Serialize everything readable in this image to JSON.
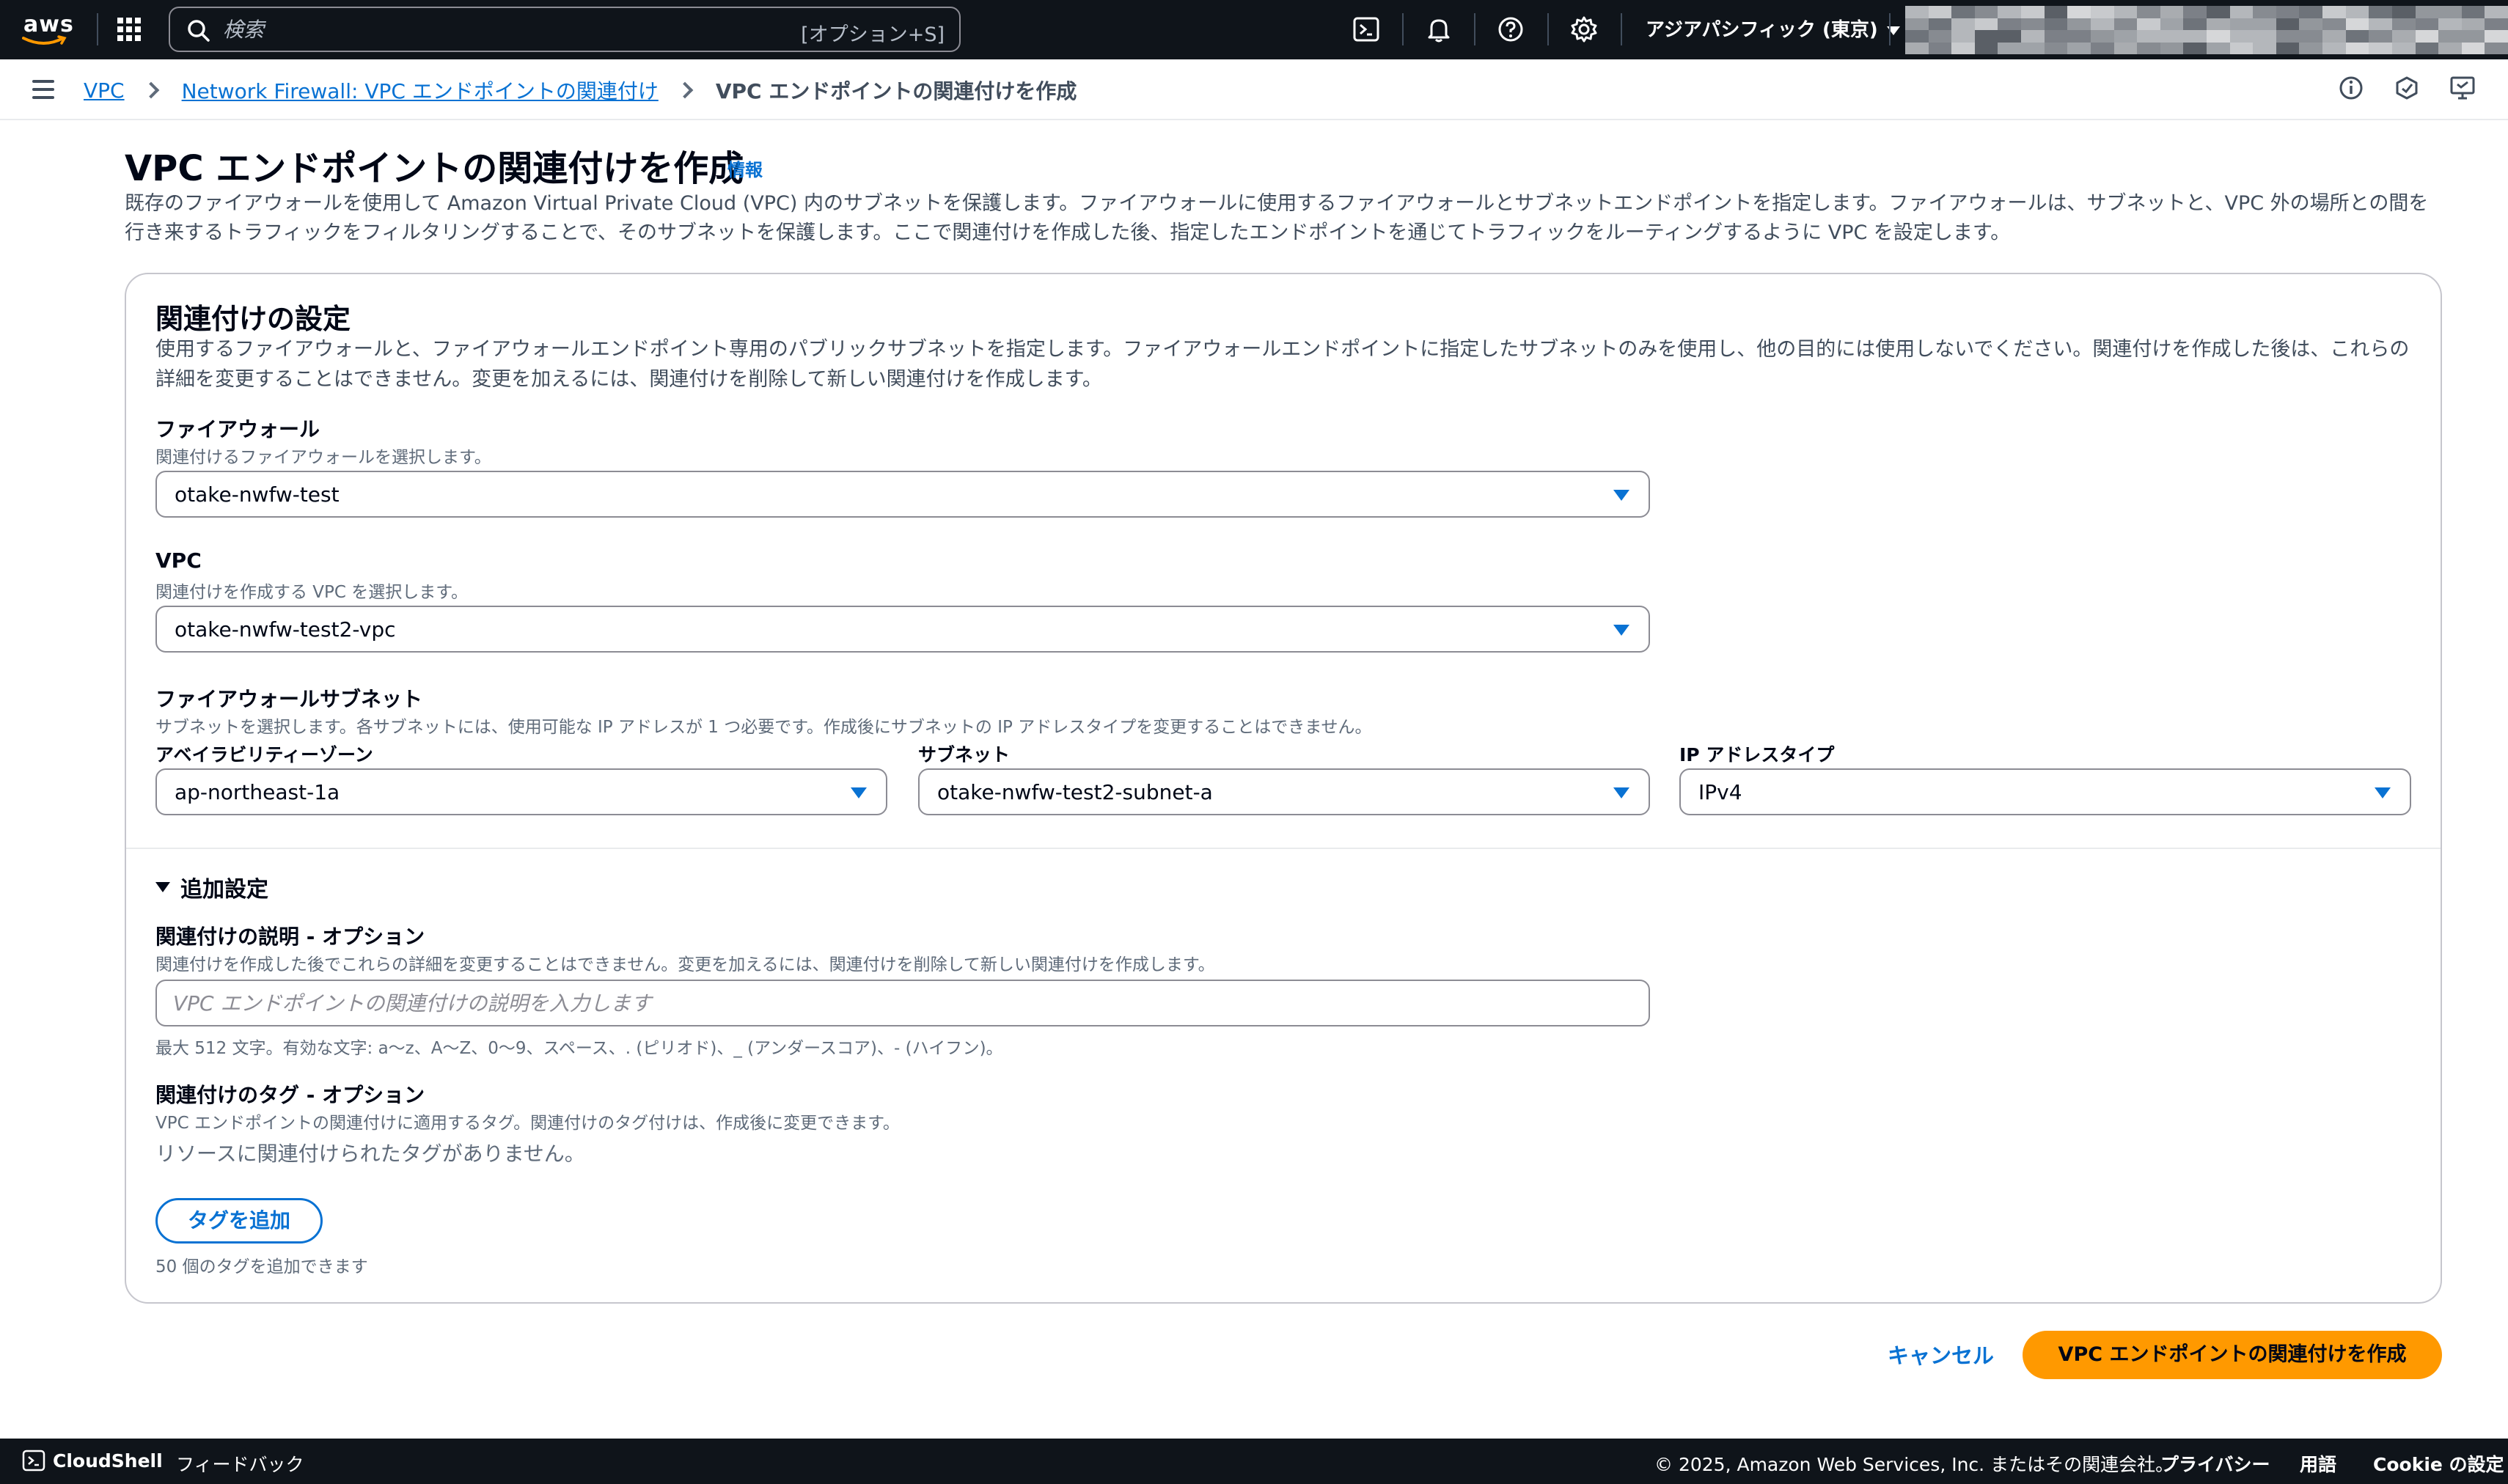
{
  "header": {
    "logo_text": "aws",
    "search": {
      "placeholder": "検索",
      "shortcut": "[オプション+S]"
    },
    "region": "アジアパシフィック (東京)"
  },
  "breadcrumb": {
    "items": [
      "VPC",
      "Network Firewall: VPC エンドポイントの関連付け"
    ],
    "current": "VPC エンドポイントの関連付けを作成"
  },
  "page": {
    "title": "VPC エンドポイントの関連付けを作成",
    "info_label": "情報",
    "description": "既存のファイアウォールを使用して Amazon Virtual Private Cloud (VPC) 内のサブネットを保護します。ファイアウォールに使用するファイアウォールとサブネットエンドポイントを指定します。ファイアウォールは、サブネットと、VPC 外の場所との間を行き来するトラフィックをフィルタリングすることで、そのサブネットを保護します。ここで関連付けを作成した後、指定したエンドポイントを通じてトラフィックをルーティングするように VPC を設定します。"
  },
  "panel": {
    "title": "関連付けの設定",
    "description": "使用するファイアウォールと、ファイアウォールエンドポイント専用のパブリックサブネットを指定します。ファイアウォールエンドポイントに指定したサブネットのみを使用し、他の目的には使用しないでください。関連付けを作成した後は、これらの詳細を変更することはできません。変更を加えるには、関連付けを削除して新しい関連付けを作成します。",
    "firewall": {
      "label": "ファイアウォール",
      "description": "関連付けるファイアウォールを選択します。",
      "value": "otake-nwfw-test"
    },
    "vpc": {
      "label": "VPC",
      "description": "関連付けを作成する VPC を選択します。",
      "value": "otake-nwfw-test2-vpc"
    },
    "subnets": {
      "label": "ファイアウォールサブネット",
      "description": "サブネットを選択します。各サブネットには、使用可能な IP アドレスが 1 つ必要です。作成後にサブネットの IP アドレスタイプを変更することはできません。",
      "az_label": "アベイラビリティーゾーン",
      "az_value": "ap-northeast-1a",
      "subnet_label": "サブネット",
      "subnet_value": "otake-nwfw-test2-subnet-a",
      "ip_label": "IP アドレスタイプ",
      "ip_value": "IPv4"
    },
    "additional": {
      "label": "追加設定",
      "description_field": {
        "label": "関連付けの説明 - オプション",
        "description": "関連付けを作成した後でこれらの詳細を変更することはできません。変更を加えるには、関連付けを削除して新しい関連付けを作成します。",
        "placeholder": "VPC エンドポイントの関連付けの説明を入力します",
        "value": "",
        "hint": "最大 512 文字。有効な文字: a〜z、A〜Z、0〜9、スペース、. (ピリオド)、_ (アンダースコア)、- (ハイフン)。"
      },
      "tags": {
        "label": "関連付けのタグ - オプション",
        "description": "VPC エンドポイントの関連付けに適用するタグ。関連付けのタグ付けは、作成後に変更できます。",
        "empty": "リソースに関連付けられたタグがありません。",
        "add_button": "タグを追加",
        "limit": "50 個のタグを追加できます"
      }
    }
  },
  "actions": {
    "cancel": "キャンセル",
    "create": "VPC エンドポイントの関連付けを作成"
  },
  "footer": {
    "cloudshell": "CloudShell",
    "feedback": "フィードバック",
    "copyright": "© 2025, Amazon Web Services, Inc. またはその関連会社。",
    "privacy": "プライバシー",
    "terms": "用語",
    "cookie": "Cookie の設定"
  },
  "colors": {
    "nav_bg": "#0f141a",
    "link": "#0972d3",
    "primary": "#ff9900",
    "text": "#000716",
    "muted": "#5f6b7a"
  }
}
